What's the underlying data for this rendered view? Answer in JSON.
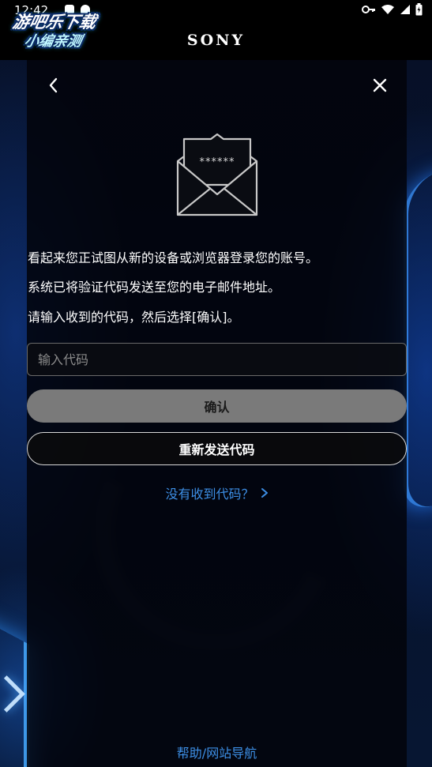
{
  "status_bar": {
    "time": "12:42",
    "icons": [
      "key-icon",
      "wifi-icon",
      "signal-icon",
      "battery-charging-icon"
    ]
  },
  "header": {
    "brand": "SONY",
    "watermark": {
      "line1": "游吧乐下载",
      "line2": "小编亲测"
    }
  },
  "dialog": {
    "back_icon": "chevron-left-icon",
    "close_icon": "close-icon",
    "envelope": {
      "icon": "envelope-open-icon",
      "masked_code": "******"
    },
    "messages": [
      "看起来您正试图从新的设备或浏览器登录您的账号。",
      "系统已将验证代码发送至您的电子邮件地址。",
      "请输入收到的代码，然后选择[确认]。"
    ],
    "code_input": {
      "placeholder": "输入代码",
      "value": ""
    },
    "confirm_label": "确认",
    "resend_label": "重新发送代码",
    "no_code_link": "没有收到代码？",
    "help_link": "帮助/网站导航"
  },
  "colors": {
    "link": "#3d8fe6",
    "confirm_bg": "#7a7a7a",
    "panel_bg": "#02040a"
  }
}
